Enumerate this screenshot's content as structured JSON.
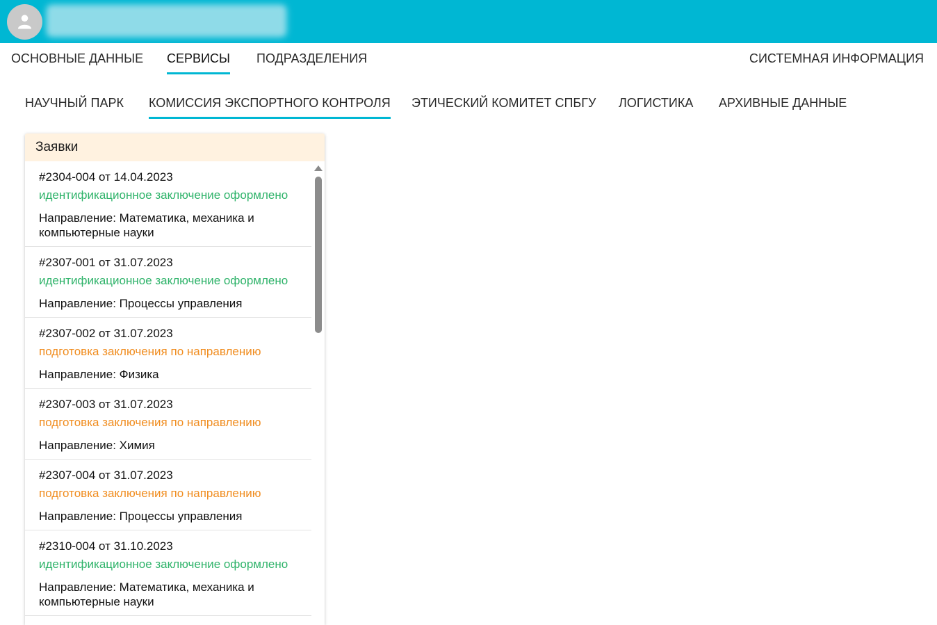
{
  "main_tabs": [
    {
      "label": "ОСНОВНЫЕ ДАННЫЕ"
    },
    {
      "label": "СЕРВИСЫ"
    },
    {
      "label": "ПОДРАЗДЕЛЕНИЯ"
    },
    {
      "label": "СИСТЕМНАЯ ИНФОРМАЦИЯ"
    }
  ],
  "sub_tabs": [
    {
      "label": "НАУЧНЫЙ ПАРК"
    },
    {
      "label": "КОМИССИЯ ЭКСПОРТНОГО КОНТРОЛЯ"
    },
    {
      "label": "ЭТИЧЕСКИЙ КОМИТЕТ СПБГУ"
    },
    {
      "label": "ЛОГИСТИКА"
    },
    {
      "label": "АРХИВНЫЕ ДАННЫЕ"
    }
  ],
  "panel": {
    "title": "Заявки",
    "items": [
      {
        "title": "#2304-004 от 14.04.2023",
        "status": "идентификационное заключение оформлено",
        "direction": "Направление: Математика, механика и компьютерные науки"
      },
      {
        "title": "#2307-001 от 31.07.2023",
        "status": "идентификационное заключение оформлено",
        "direction": "Направление: Процессы управления"
      },
      {
        "title": "#2307-002 от 31.07.2023",
        "status": "подготовка заключения по направлению",
        "direction": "Направление: Физика"
      },
      {
        "title": "#2307-003 от 31.07.2023",
        "status": "подготовка заключения по направлению",
        "direction": "Направление: Химия"
      },
      {
        "title": "#2307-004 от 31.07.2023",
        "status": "подготовка заключения по направлению",
        "direction": "Направление: Процессы управления"
      },
      {
        "title": "#2310-004 от 31.10.2023",
        "status": "идентификационное заключение оформлено",
        "direction": "Направление: Математика, механика и компьютерные науки"
      }
    ]
  },
  "colors": {
    "accent": "#00b7d3",
    "status_done": "#2fb36a",
    "status_progress": "#f08c1e",
    "panel_header_bg": "#fff2e0"
  }
}
